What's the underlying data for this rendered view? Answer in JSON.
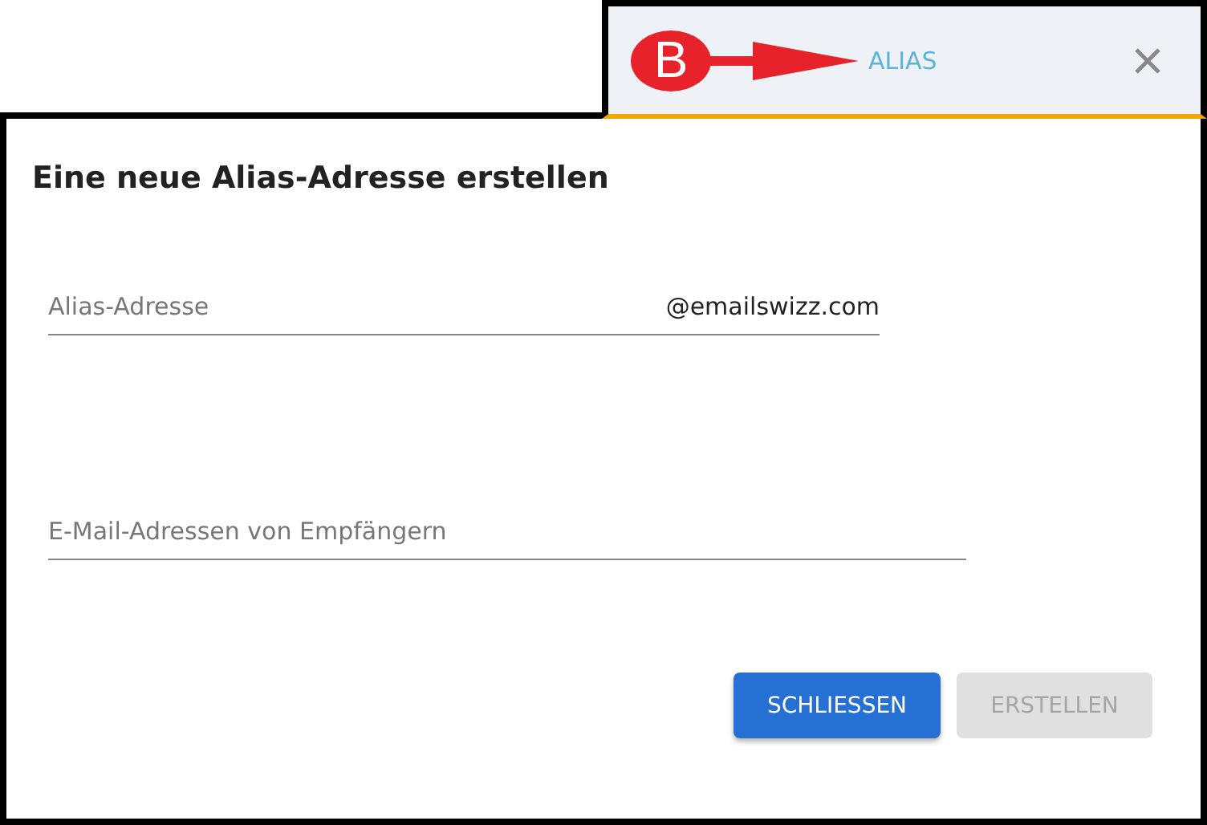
{
  "annotation": {
    "marker": "B"
  },
  "tab": {
    "label": "ALIAS"
  },
  "dialog": {
    "title": "Eine neue Alias-Adresse erstellen",
    "fields": [
      {
        "placeholder": "Alias-Adresse",
        "suffix": "@emailswizz.com"
      },
      {
        "placeholder": "E-Mail-Adressen von Empfängern"
      }
    ],
    "buttons": [
      {
        "label": "SCHLIESSEN",
        "disabled": false
      },
      {
        "label": "ERSTELLEN",
        "disabled": true
      }
    ]
  }
}
